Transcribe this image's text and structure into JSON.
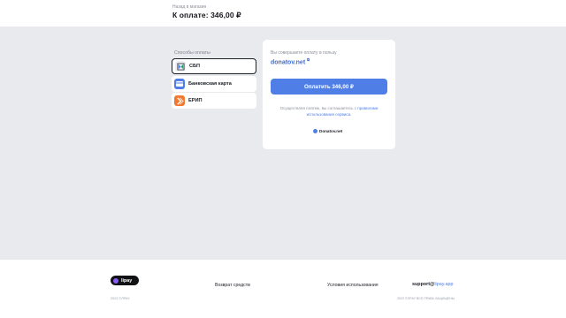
{
  "header": {
    "back_label": "Назад в магазин",
    "total_label": "К оплате: 346,00 ₽"
  },
  "methods": {
    "title": "Способы оплаты",
    "items": [
      {
        "label": "СБП",
        "icon": "sbp-icon"
      },
      {
        "label": "Банковская карта",
        "icon": "bank-card-icon"
      },
      {
        "label": "ЕРИП",
        "icon": "erip-icon"
      }
    ]
  },
  "payment": {
    "note": "Вы совершаете оплату в пользу",
    "target": "donatov.net",
    "target_sup": "📋",
    "button_label": "Оплатить 346,00 ₽",
    "terms_text": "Осуществляя платеж, вы соглашаетесь с",
    "terms_link": "правилами использования сервиса.",
    "brand": "Donatov.net"
  },
  "footer": {
    "logo": "lipay",
    "refund": "Возврат средств",
    "terms": "Условия использования",
    "email_prefix": "support@",
    "email_domain": "lipay.app",
    "copyright_left": "2022 ©ЛPAY",
    "copyright_right": "2022 ©ЛРАУ ВСЕ ПРАВА ЗАЩИЩЕНЫ"
  },
  "colors": {
    "accent": "#4f7fe6",
    "background": "#e9eaee",
    "sbp_icon_bg": "#eef0f4",
    "card_icon_bg": "#4f7fe6",
    "erip_icon_bg": "#f2772f"
  }
}
